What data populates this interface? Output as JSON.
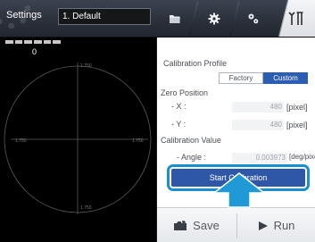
{
  "header": {
    "settings_label": "Settings",
    "profile_value": "1. Default"
  },
  "camera": {
    "status_value": "0",
    "scale_top": "1.750",
    "scale_bottom": "1.750",
    "scale_left": "1.750",
    "scale_right": "1.750"
  },
  "panel": {
    "calibration_profile_label": "Calibration Profile",
    "factory_label": "Factory",
    "custom_label": "Custom",
    "zero_position_label": "Zero Position",
    "x_label": "- X   :",
    "x_value": "480",
    "x_unit": "[pixel]",
    "y_label": "- Y   :",
    "y_value": "480",
    "y_unit": "[pixel]",
    "calibration_value_label": "Calibration Value",
    "angle_label": "- Angle  :",
    "angle_value": "0.003973",
    "angle_unit": "[deg/pixel]",
    "start_calibration_label": "Start Calibration"
  },
  "bottom": {
    "save_label": "Save",
    "run_label": "Run"
  },
  "colors": {
    "accent": "#2e57a8",
    "highlight": "#1a8fd0",
    "selected_toggle": "#2b5db4"
  },
  "icons": [
    "folder-icon",
    "gear-icon",
    "tools-icon",
    "calibration-tab-icon",
    "save-icon",
    "run-icon",
    "arrow-up-icon"
  ]
}
